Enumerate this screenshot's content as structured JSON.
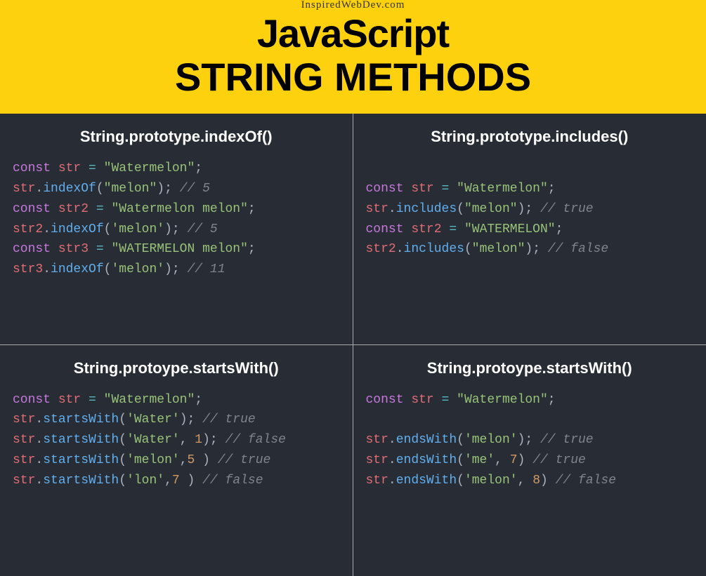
{
  "header": {
    "source": "InspiredWebDev.com",
    "title1": "JavaScript",
    "title2": "STRING METHODS"
  },
  "cells": [
    {
      "title": "String.prototype.indexOf()",
      "lines": [
        [
          {
            "t": "const ",
            "c": "kw"
          },
          {
            "t": "str",
            "c": "var"
          },
          {
            "t": " ",
            "c": "pn"
          },
          {
            "t": "=",
            "c": "op"
          },
          {
            "t": " ",
            "c": "pn"
          },
          {
            "t": "\"Watermelon\"",
            "c": "str"
          },
          {
            "t": ";",
            "c": "pn"
          }
        ],
        [
          {
            "t": "str",
            "c": "var"
          },
          {
            "t": ".",
            "c": "pn"
          },
          {
            "t": "indexOf",
            "c": "fn"
          },
          {
            "t": "(",
            "c": "pn"
          },
          {
            "t": "\"melon\"",
            "c": "str"
          },
          {
            "t": "); ",
            "c": "pn"
          },
          {
            "t": "// 5",
            "c": "cm"
          }
        ],
        [
          {
            "t": "const ",
            "c": "kw"
          },
          {
            "t": "str2",
            "c": "var"
          },
          {
            "t": " ",
            "c": "pn"
          },
          {
            "t": "=",
            "c": "op"
          },
          {
            "t": " ",
            "c": "pn"
          },
          {
            "t": "\"Watermelon melon\"",
            "c": "str"
          },
          {
            "t": ";",
            "c": "pn"
          }
        ],
        [
          {
            "t": "str2",
            "c": "var"
          },
          {
            "t": ".",
            "c": "pn"
          },
          {
            "t": "indexOf",
            "c": "fn"
          },
          {
            "t": "(",
            "c": "pn"
          },
          {
            "t": "'melon'",
            "c": "str"
          },
          {
            "t": "); ",
            "c": "pn"
          },
          {
            "t": "// 5",
            "c": "cm"
          }
        ],
        [
          {
            "t": "const ",
            "c": "kw"
          },
          {
            "t": "str3",
            "c": "var"
          },
          {
            "t": " ",
            "c": "pn"
          },
          {
            "t": "=",
            "c": "op"
          },
          {
            "t": " ",
            "c": "pn"
          },
          {
            "t": "\"WATERMELON melon\"",
            "c": "str"
          },
          {
            "t": ";",
            "c": "pn"
          }
        ],
        [
          {
            "t": "str3",
            "c": "var"
          },
          {
            "t": ".",
            "c": "pn"
          },
          {
            "t": "indexOf",
            "c": "fn"
          },
          {
            "t": "(",
            "c": "pn"
          },
          {
            "t": "'melon'",
            "c": "str"
          },
          {
            "t": "); ",
            "c": "pn"
          },
          {
            "t": "// 11",
            "c": "cm"
          }
        ]
      ]
    },
    {
      "title": "String.prototype.includes()",
      "leadingBlank": true,
      "lines": [
        [
          {
            "t": "const ",
            "c": "kw"
          },
          {
            "t": "str",
            "c": "var"
          },
          {
            "t": " ",
            "c": "pn"
          },
          {
            "t": "=",
            "c": "op"
          },
          {
            "t": " ",
            "c": "pn"
          },
          {
            "t": "\"Watermelon\"",
            "c": "str"
          },
          {
            "t": ";",
            "c": "pn"
          }
        ],
        [
          {
            "t": "str",
            "c": "var"
          },
          {
            "t": ".",
            "c": "pn"
          },
          {
            "t": "includes",
            "c": "fn"
          },
          {
            "t": "(",
            "c": "pn"
          },
          {
            "t": "\"melon\"",
            "c": "str"
          },
          {
            "t": "); ",
            "c": "pn"
          },
          {
            "t": "// true",
            "c": "cm"
          }
        ],
        [
          {
            "t": "const ",
            "c": "kw"
          },
          {
            "t": "str2",
            "c": "var"
          },
          {
            "t": " ",
            "c": "pn"
          },
          {
            "t": "=",
            "c": "op"
          },
          {
            "t": " ",
            "c": "pn"
          },
          {
            "t": "\"WATERMELON\"",
            "c": "str"
          },
          {
            "t": ";",
            "c": "pn"
          }
        ],
        [
          {
            "t": "str2",
            "c": "var"
          },
          {
            "t": ".",
            "c": "pn"
          },
          {
            "t": "includes",
            "c": "fn"
          },
          {
            "t": "(",
            "c": "pn"
          },
          {
            "t": "\"melon\"",
            "c": "str"
          },
          {
            "t": "); ",
            "c": "pn"
          },
          {
            "t": "// false",
            "c": "cm"
          }
        ]
      ]
    },
    {
      "title": "String.protoype.startsWith()",
      "lines": [
        [
          {
            "t": "const ",
            "c": "kw"
          },
          {
            "t": "str",
            "c": "var"
          },
          {
            "t": " ",
            "c": "pn"
          },
          {
            "t": "=",
            "c": "op"
          },
          {
            "t": " ",
            "c": "pn"
          },
          {
            "t": "\"Watermelon\"",
            "c": "str"
          },
          {
            "t": ";",
            "c": "pn"
          }
        ],
        [
          {
            "t": "str",
            "c": "var"
          },
          {
            "t": ".",
            "c": "pn"
          },
          {
            "t": "startsWith",
            "c": "fn"
          },
          {
            "t": "(",
            "c": "pn"
          },
          {
            "t": "'Water'",
            "c": "str"
          },
          {
            "t": "); ",
            "c": "pn"
          },
          {
            "t": "// true",
            "c": "cm"
          }
        ],
        [
          {
            "t": "str",
            "c": "var"
          },
          {
            "t": ".",
            "c": "pn"
          },
          {
            "t": "startsWith",
            "c": "fn"
          },
          {
            "t": "(",
            "c": "pn"
          },
          {
            "t": "'Water'",
            "c": "str"
          },
          {
            "t": ", ",
            "c": "pn"
          },
          {
            "t": "1",
            "c": "num"
          },
          {
            "t": "); ",
            "c": "pn"
          },
          {
            "t": "// false",
            "c": "cm"
          }
        ],
        [
          {
            "t": "str",
            "c": "var"
          },
          {
            "t": ".",
            "c": "pn"
          },
          {
            "t": "startsWith",
            "c": "fn"
          },
          {
            "t": "(",
            "c": "pn"
          },
          {
            "t": "'melon'",
            "c": "str"
          },
          {
            "t": ",",
            "c": "pn"
          },
          {
            "t": "5",
            "c": "num"
          },
          {
            "t": " ) ",
            "c": "pn"
          },
          {
            "t": "// true",
            "c": "cm"
          }
        ],
        [
          {
            "t": "str",
            "c": "var"
          },
          {
            "t": ".",
            "c": "pn"
          },
          {
            "t": "startsWith",
            "c": "fn"
          },
          {
            "t": "(",
            "c": "pn"
          },
          {
            "t": "'lon'",
            "c": "str"
          },
          {
            "t": ",",
            "c": "pn"
          },
          {
            "t": "7",
            "c": "num"
          },
          {
            "t": " ) ",
            "c": "pn"
          },
          {
            "t": "// false",
            "c": "cm"
          }
        ]
      ]
    },
    {
      "title": "String.protoype.startsWith()",
      "lines": [
        [
          {
            "t": "const ",
            "c": "kw"
          },
          {
            "t": "str",
            "c": "var"
          },
          {
            "t": " ",
            "c": "pn"
          },
          {
            "t": "=",
            "c": "op"
          },
          {
            "t": " ",
            "c": "pn"
          },
          {
            "t": "\"Watermelon\"",
            "c": "str"
          },
          {
            "t": ";",
            "c": "pn"
          }
        ],
        [],
        [
          {
            "t": "str",
            "c": "var"
          },
          {
            "t": ".",
            "c": "pn"
          },
          {
            "t": "endsWith",
            "c": "fn"
          },
          {
            "t": "(",
            "c": "pn"
          },
          {
            "t": "'melon'",
            "c": "str"
          },
          {
            "t": "); ",
            "c": "pn"
          },
          {
            "t": "// true",
            "c": "cm"
          }
        ],
        [
          {
            "t": "str",
            "c": "var"
          },
          {
            "t": ".",
            "c": "pn"
          },
          {
            "t": "endsWith",
            "c": "fn"
          },
          {
            "t": "(",
            "c": "pn"
          },
          {
            "t": "'me'",
            "c": "str"
          },
          {
            "t": ", ",
            "c": "pn"
          },
          {
            "t": "7",
            "c": "num"
          },
          {
            "t": ") ",
            "c": "pn"
          },
          {
            "t": "// true",
            "c": "cm"
          }
        ],
        [
          {
            "t": "str",
            "c": "var"
          },
          {
            "t": ".",
            "c": "pn"
          },
          {
            "t": "endsWith",
            "c": "fn"
          },
          {
            "t": "(",
            "c": "pn"
          },
          {
            "t": "'melon'",
            "c": "str"
          },
          {
            "t": ", ",
            "c": "pn"
          },
          {
            "t": "8",
            "c": "num"
          },
          {
            "t": ") ",
            "c": "pn"
          },
          {
            "t": "// false",
            "c": "cm"
          }
        ]
      ]
    }
  ]
}
